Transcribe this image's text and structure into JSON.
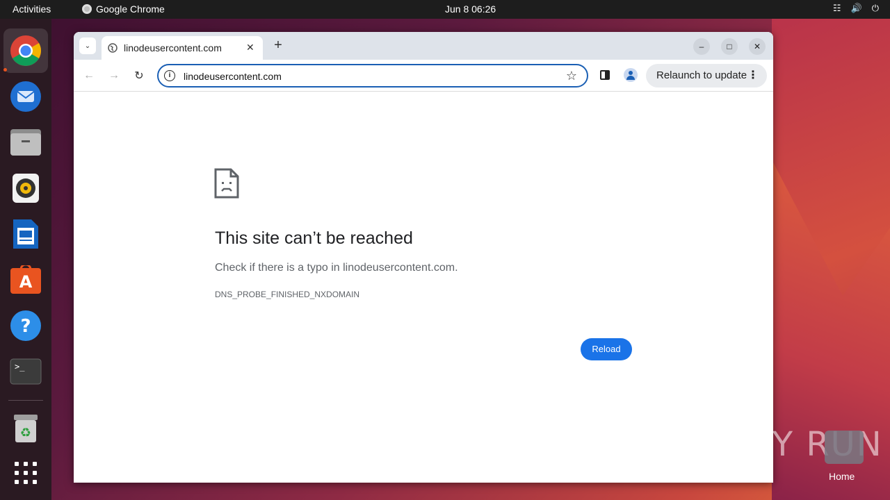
{
  "topbar": {
    "activities": "Activities",
    "app_name": "Google Chrome",
    "clock": "Jun 8  06:26"
  },
  "dock": {
    "items": [
      "chrome-icon",
      "thunderbird-icon",
      "files-icon",
      "rhythmbox-icon",
      "libreoffice-writer-icon",
      "app-center-icon",
      "help-icon",
      "terminal-icon",
      "trash-icon",
      "show-apps-icon"
    ]
  },
  "browser": {
    "tab_title": "linodeusercontent.com",
    "address": "linodeusercontent.com",
    "relaunch_label": "Relaunch to update"
  },
  "error_page": {
    "title": "This site can’t be reached",
    "message": "Check if there is a typo in linodeusercontent.com.",
    "code": "DNS_PROBE_FINISHED_NXDOMAIN",
    "reload_label": "Reload"
  },
  "desktop": {
    "watermark": "ANY RUN",
    "home_label": "Home"
  },
  "colors": {
    "accent": "#1a73e8",
    "ubuntu_orange": "#e95420"
  }
}
